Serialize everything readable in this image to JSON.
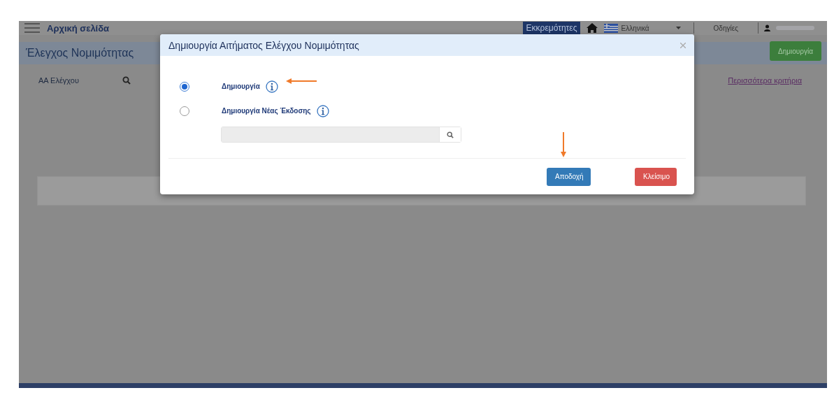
{
  "topbar": {
    "home_link": "Αρχική σελίδα",
    "pending_button": "Εκκρεμότητες",
    "language": "Ελληνικά",
    "guides_link": "Οδηγίες"
  },
  "page": {
    "title": "Έλεγχος Νομιμότητας",
    "create_button": "Δημιουργία",
    "filter_label": "ΑΑ Ελέγχου",
    "more_criteria_link": "Περισσότερα κριτήρια"
  },
  "dialog": {
    "title": "Δημιουργία Αιτήματος Ελέγχου Νομιμότητας",
    "options": [
      {
        "label": "Δημιουργία",
        "selected": true
      },
      {
        "label": "Δημιουργία Νέας Έκδοσης",
        "selected": false
      }
    ],
    "search_field": {
      "disabled": true
    },
    "buttons": [
      {
        "label": "Αποδοχή",
        "kind": "primary"
      },
      {
        "label": "Κλείσιμο",
        "kind": "danger"
      }
    ]
  }
}
